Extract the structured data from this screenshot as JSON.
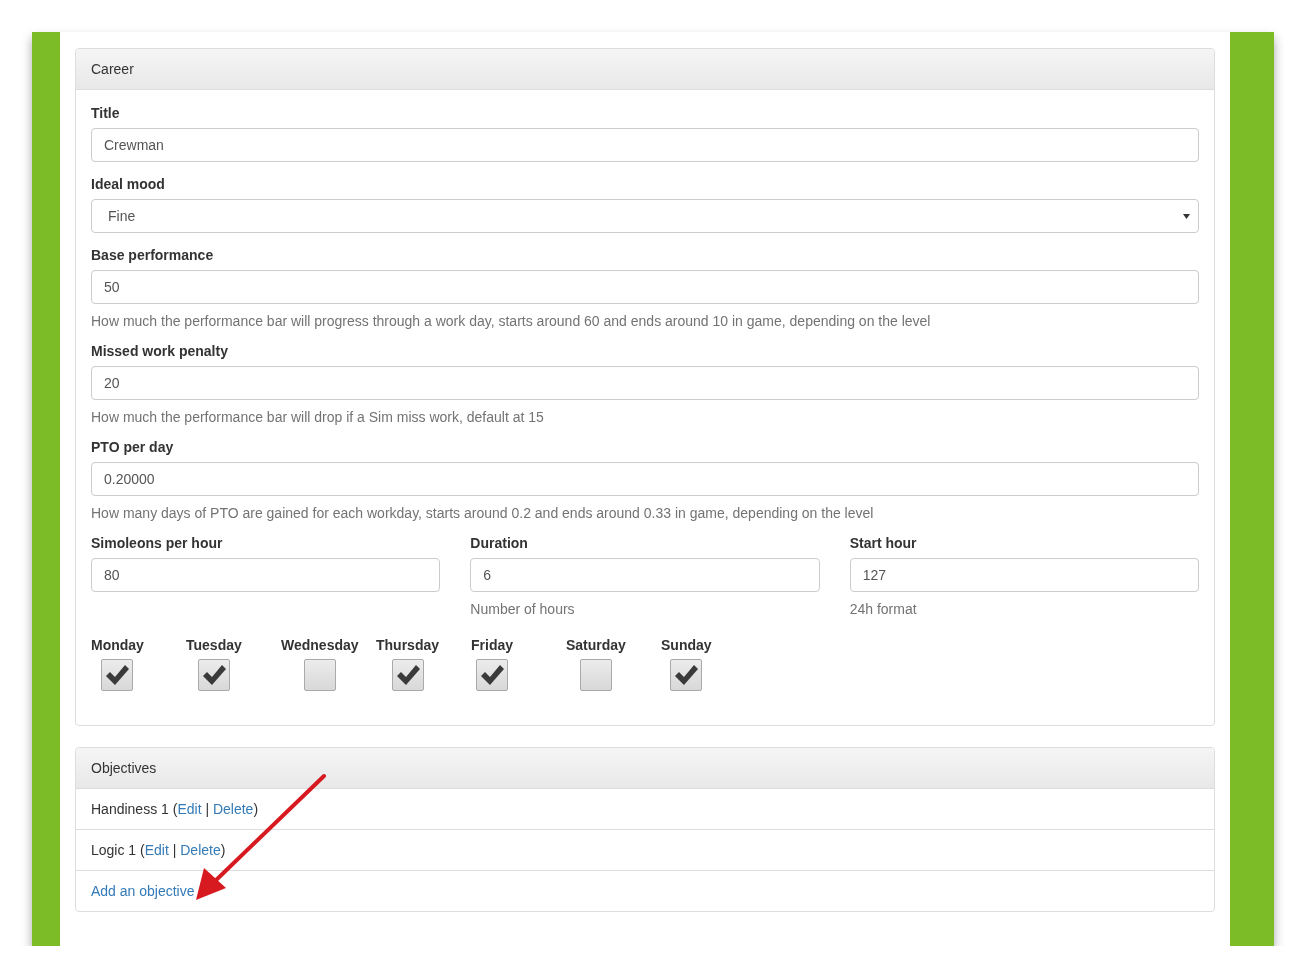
{
  "career": {
    "title": "Career",
    "fields": [
      {
        "label": "Title",
        "value": "Crewman",
        "kind": "text"
      },
      {
        "label": "Ideal mood",
        "value": "Fine",
        "kind": "select"
      },
      {
        "label": "Base performance",
        "value": "50",
        "kind": "text",
        "help": "How much the performance bar will progress through a work day, starts around 60 and ends around 10 in game, depending on the level"
      },
      {
        "label": "Missed work penalty",
        "value": "20",
        "kind": "text",
        "help": "How much the performance bar will drop if a Sim miss work, default at 15"
      },
      {
        "label": "PTO per day",
        "value": "0.20000",
        "kind": "text",
        "help": "How many days of PTO are gained for each workday, starts around 0.2 and ends around 0.33 in game, depending on the level"
      }
    ],
    "columns": [
      {
        "label": "Simoleons per hour",
        "value": "80"
      },
      {
        "label": "Duration",
        "value": "6",
        "help": "Number of hours"
      },
      {
        "label": "Start hour",
        "value": "127",
        "help": "24h format"
      }
    ],
    "days": [
      {
        "label": "Monday",
        "checked": true
      },
      {
        "label": "Tuesday",
        "checked": true
      },
      {
        "label": "Wednesday",
        "checked": false
      },
      {
        "label": "Thursday",
        "checked": true
      },
      {
        "label": "Friday",
        "checked": true
      },
      {
        "label": "Saturday",
        "checked": false
      },
      {
        "label": "Sunday",
        "checked": true
      }
    ]
  },
  "objectives": {
    "title": "Objectives",
    "items": [
      {
        "parts": [
          {
            "kind": "text",
            "text": "Handiness 1 ("
          },
          {
            "kind": "link",
            "text": "Edit"
          },
          {
            "kind": "text",
            "text": " | "
          },
          {
            "kind": "link",
            "text": "Delete"
          },
          {
            "kind": "text",
            "text": ")"
          }
        ]
      },
      {
        "parts": [
          {
            "kind": "text",
            "text": "Logic 1 ("
          },
          {
            "kind": "link",
            "text": "Edit"
          },
          {
            "kind": "text",
            "text": " | "
          },
          {
            "kind": "link",
            "text": "Delete"
          },
          {
            "kind": "text",
            "text": ")"
          }
        ]
      }
    ],
    "add_link": "Add an objective"
  }
}
